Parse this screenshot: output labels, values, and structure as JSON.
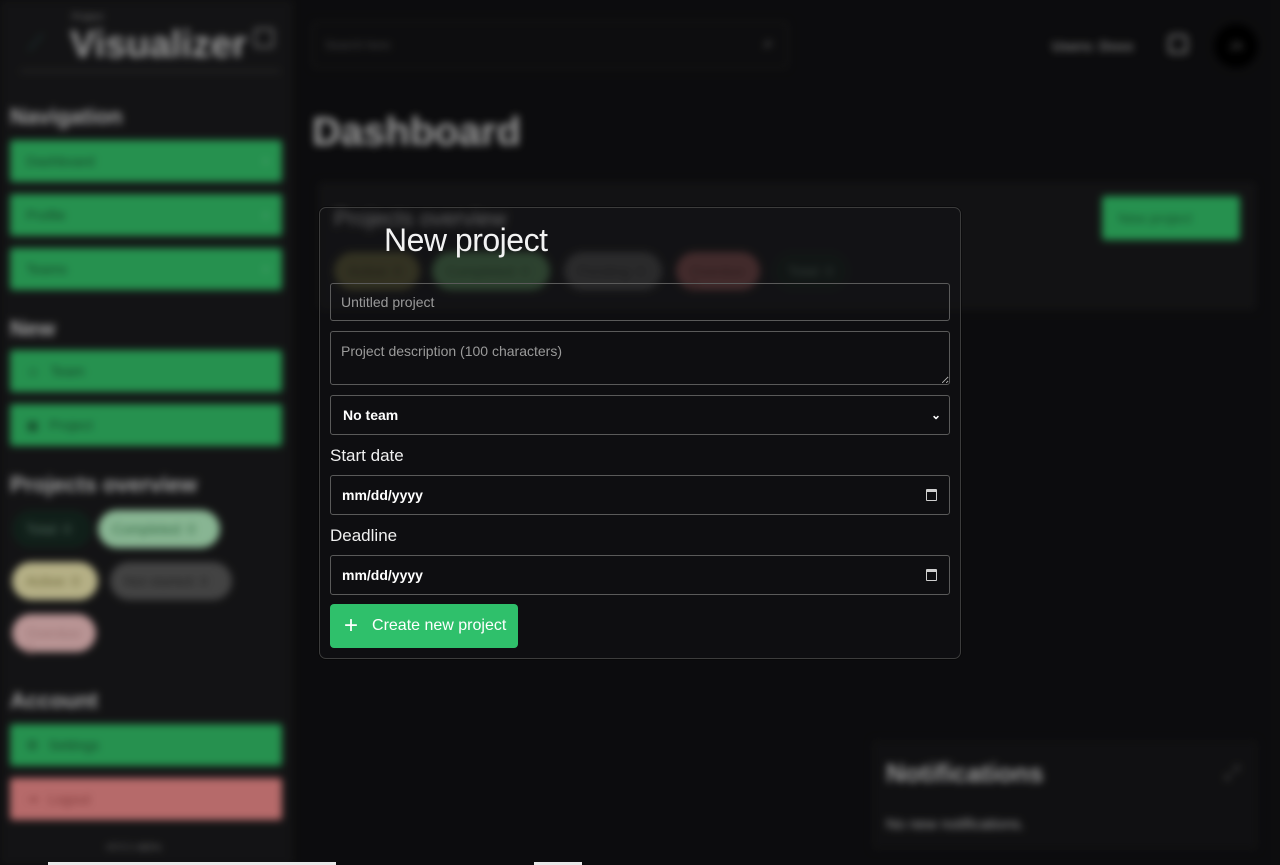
{
  "app": {
    "brand_small": "Project",
    "brand_name": "Visualizer",
    "version": "v0.0.1-alpha",
    "search_placeholder": "Search here",
    "user_label": "Users: Doxx",
    "avatar_initials": "JA",
    "page_title": "Dashboard"
  },
  "sidebar": {
    "navigation_title": "Navigation",
    "navigation": [
      {
        "label": "Dashboard"
      },
      {
        "label": "Profile"
      },
      {
        "label": "Teams"
      }
    ],
    "new_title": "New",
    "new_items": [
      {
        "label": "Team",
        "icon": "user-icon"
      },
      {
        "label": "Project",
        "icon": "folder-icon"
      }
    ],
    "overview_title": "Projects overview",
    "overview_pills": [
      {
        "label": "Total: 0"
      },
      {
        "label": "Completed: 0"
      },
      {
        "label": "Active: 0"
      },
      {
        "label": "Not started: 0"
      },
      {
        "label": "Overdue: 0"
      }
    ],
    "account_title": "Account",
    "account": [
      {
        "label": "Settings"
      },
      {
        "label": "Logout"
      }
    ]
  },
  "overview_card": {
    "title": "Projects overview",
    "new_project_label": "New project",
    "pills": [
      {
        "label": "Active: 0"
      },
      {
        "label": "Completed: 0"
      },
      {
        "label": "Pending: 0"
      },
      {
        "label": "Overdue: 0"
      },
      {
        "label": "Total: 0"
      }
    ]
  },
  "notifications": {
    "title": "Notifications",
    "empty": "No new notifications."
  },
  "modal": {
    "title": "New project",
    "name_placeholder": "Untitled project",
    "description_placeholder": "Project description (100 characters)",
    "team_selected": "No team",
    "start_label": "Start date",
    "start_value": "mm/dd/yyyy",
    "deadline_label": "Deadline",
    "deadline_value": "mm/dd/yyyy",
    "submit_label": "Create new project"
  },
  "colors": {
    "accent": "#33c26a",
    "danger": "#f38e8e",
    "background": "#111113"
  }
}
